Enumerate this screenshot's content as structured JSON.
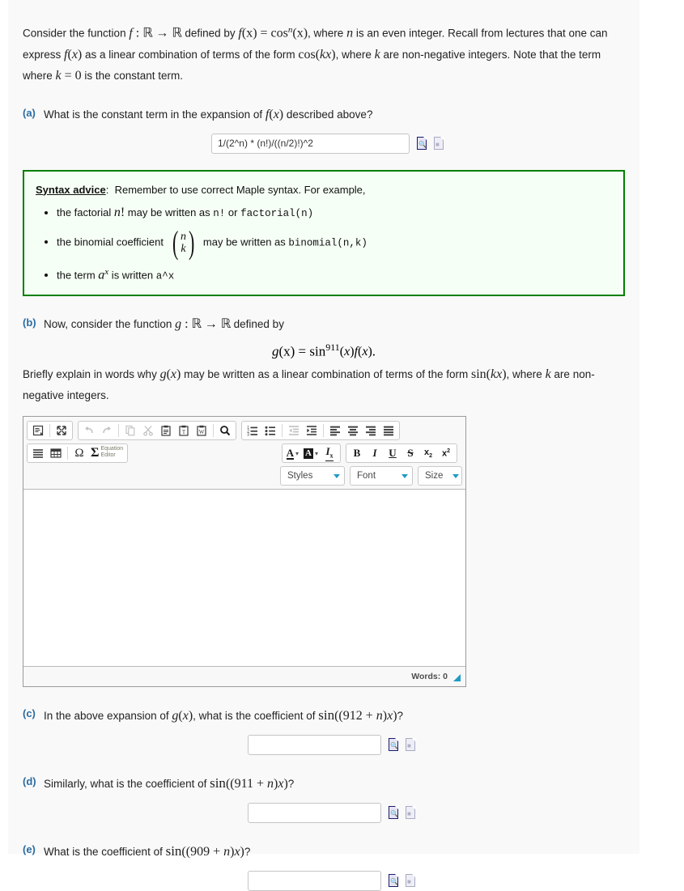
{
  "intro": {
    "line1_a": "Consider the function ",
    "line1_f": "f",
    "line1_colon": " : ",
    "line1_R1": "R",
    "line1_arrow": " → ",
    "line1_R2": "R",
    "line1_b": " defined by ",
    "line1_eq_f": "f",
    "line1_eq_px": "(x)",
    "line1_eq_equals": " = ",
    "line1_eq_cos": "cos",
    "line1_eq_sup": "n",
    "line1_eq_arg": "(x)",
    "line1_c": ", where ",
    "line1_n": "n",
    "line1_d": " is an even integer. Recall from lectures",
    "line2_a": "that one can express ",
    "line2_f": "f(x)",
    "line2_b": " as a linear combination of terms of the form ",
    "line2_cos": "cos(kx)",
    "line2_c": ", where ",
    "line2_k": "k",
    "line2_d": " are non-negative integers.",
    "line3_a": "Note that the term where ",
    "line3_k0": "k = 0",
    "line3_b": " is the constant term."
  },
  "parts": {
    "a": {
      "label": "(a)",
      "text_before": "What is the constant term in the expansion of ",
      "math": "f(x)",
      "text_after": " described above?",
      "input_value": "1/(2^n) * (n!)/((n/2)!)^2",
      "input_placeholder": ""
    },
    "b": {
      "label": "(b)",
      "text_before": "Now, consider the function ",
      "math_g": "g",
      "math_colon": " : ",
      "math_R1": "R",
      "math_arrow": " → ",
      "math_R2": "R",
      "text_after": " defined by",
      "equation_g": "g",
      "equation_gx": "(x)",
      "equation_eq": " = ",
      "equation_sin": "sin",
      "equation_exp": "911",
      "equation_xfx": "(x)f(x)",
      "equation_period": ".",
      "explain_a": "Briefly explain in words why ",
      "explain_g": "g(x)",
      "explain_b": " may be written as a linear combination of terms of the form ",
      "explain_sin": "sin(kx)",
      "explain_c": ", where ",
      "explain_k": "k",
      "explain_d": " are",
      "explain_e": "non-negative integers."
    },
    "c": {
      "label": "(c)",
      "text_before": "In the above expansion of ",
      "math_g": "g(x)",
      "text_mid": ", what is the coefficient of ",
      "math_sin": "sin",
      "math_arg": "((912 + n)x)",
      "text_after": "?",
      "input_value": "",
      "input_placeholder": ""
    },
    "d": {
      "label": "(d)",
      "text_before": "Similarly, what is the coefficient of ",
      "math_sin": "sin",
      "math_arg": "((911 + n)x)",
      "text_after": "?",
      "input_value": "",
      "input_placeholder": ""
    },
    "e": {
      "label": "(e)",
      "text_before": "What is the coefficient of ",
      "math_sin": "sin",
      "math_arg": "((909 + n)x)",
      "text_after": "?",
      "input_value": "",
      "input_placeholder": ""
    }
  },
  "advice": {
    "title": "Syntax advice",
    "title_colon": ":",
    "intro": "Remember to use correct Maple syntax. For example,",
    "items": [
      {
        "pre": "the factorial ",
        "math": "n!",
        "mid": " may be written as ",
        "code1": "n!",
        "or": " or ",
        "code2": "factorial(n)",
        "post": ""
      },
      {
        "pre": "the binomial coefficient ",
        "binom_top": "n",
        "binom_bottom": "k",
        "mid": " may be written as ",
        "code1": "binomial(n,k)",
        "post": ""
      },
      {
        "pre": "the term ",
        "math_base": "a",
        "math_exp": "x",
        "mid": " is written ",
        "code1": "a^x",
        "post": ""
      }
    ]
  },
  "editor": {
    "toolbar_row1": [
      {
        "name": "source-icon",
        "title": "Source"
      },
      {
        "name": "maximize-icon",
        "title": "Maximize"
      },
      {
        "name": "undo-icon",
        "title": "Undo"
      },
      {
        "name": "redo-icon",
        "title": "Redo"
      },
      {
        "name": "copy-icon",
        "title": "Copy"
      },
      {
        "name": "cut-icon",
        "title": "Cut"
      },
      {
        "name": "paste-icon",
        "title": "Paste"
      },
      {
        "name": "paste-text-icon",
        "title": "Paste as plain text"
      },
      {
        "name": "paste-word-icon",
        "title": "Paste from Word"
      },
      {
        "name": "find-icon",
        "title": "Find"
      },
      {
        "name": "numbered-list-icon",
        "title": "Insert/Remove Numbered List"
      },
      {
        "name": "bulleted-list-icon",
        "title": "Insert/Remove Bulleted List"
      },
      {
        "name": "outdent-icon",
        "title": "Decrease Indent"
      },
      {
        "name": "indent-icon",
        "title": "Increase Indent"
      },
      {
        "name": "align-left-icon",
        "title": "Align Left"
      },
      {
        "name": "align-center-icon",
        "title": "Center"
      },
      {
        "name": "align-right-icon",
        "title": "Align Right"
      },
      {
        "name": "justify-icon",
        "title": "Justify"
      }
    ],
    "toolbar_row2": [
      {
        "name": "horizontal-rule-icon",
        "title": "Insert Horizontal Line"
      },
      {
        "name": "table-icon",
        "title": "Table"
      },
      {
        "name": "special-char-icon",
        "title": "Insert Special Character",
        "glyph": "Ω"
      },
      {
        "name": "equation-editor-icon",
        "title": "Equation Editor",
        "glyph": "Σ"
      },
      {
        "name": "text-color-icon",
        "title": "Text Color",
        "glyph": "A"
      },
      {
        "name": "background-color-icon",
        "title": "Background Color",
        "glyph": "A"
      },
      {
        "name": "remove-format-icon",
        "title": "Remove Format"
      },
      {
        "name": "bold-icon",
        "title": "Bold",
        "glyph": "B"
      },
      {
        "name": "italic-icon",
        "title": "Italic",
        "glyph": "I"
      },
      {
        "name": "underline-icon",
        "title": "Underline",
        "glyph": "U"
      },
      {
        "name": "strike-icon",
        "title": "Strike Through",
        "glyph": "S"
      },
      {
        "name": "subscript-icon",
        "title": "Subscript"
      },
      {
        "name": "superscript-icon",
        "title": "Superscript"
      }
    ],
    "equation_editor_label_line1": "Equation",
    "equation_editor_label_line2": "Editor",
    "combo_styles": "Styles",
    "combo_font": "Font",
    "combo_size": "Size",
    "body_value": "",
    "status_words": "Words: 0"
  },
  "colors": {
    "accent_blue": "#2b6ca3",
    "advice_green": "#008000",
    "advice_bg": "#f6fff6",
    "panel_bg": "#f9f9f9",
    "caret_teal": "#1f9bc4"
  }
}
